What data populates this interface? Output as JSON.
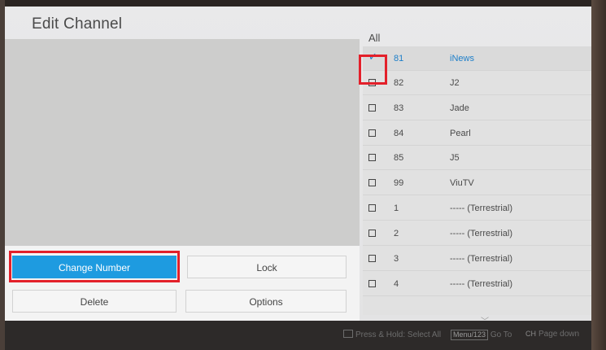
{
  "screen": {
    "title": "Edit Channel",
    "list_heading": "All"
  },
  "buttons": {
    "change_number": "Change Number",
    "lock": "Lock",
    "delete": "Delete",
    "options": "Options"
  },
  "channels": [
    {
      "number": "81",
      "name": "iNews",
      "checked": true
    },
    {
      "number": "82",
      "name": "J2",
      "checked": false
    },
    {
      "number": "83",
      "name": "Jade",
      "checked": false
    },
    {
      "number": "84",
      "name": "Pearl",
      "checked": false
    },
    {
      "number": "85",
      "name": "J5",
      "checked": false
    },
    {
      "number": "99",
      "name": "ViuTV",
      "checked": false
    },
    {
      "number": "1",
      "name": "----- (Terrestrial)",
      "checked": false
    },
    {
      "number": "2",
      "name": "----- (Terrestrial)",
      "checked": false
    },
    {
      "number": "3",
      "name": "----- (Terrestrial)",
      "checked": false
    },
    {
      "number": "4",
      "name": "----- (Terrestrial)",
      "checked": false
    }
  ],
  "footer": {
    "select_all": "Press & Hold: Select All",
    "goto_key": "Menu/123",
    "goto_label": "Go To",
    "page_key": "CH",
    "page_label": "Page down"
  },
  "colors": {
    "accent": "#1e9be0",
    "highlight_box": "#e3202a"
  },
  "icons": {
    "checkmark": "check-icon",
    "checkbox": "checkbox-icon",
    "scroll_down": "chevron-down-icon"
  }
}
